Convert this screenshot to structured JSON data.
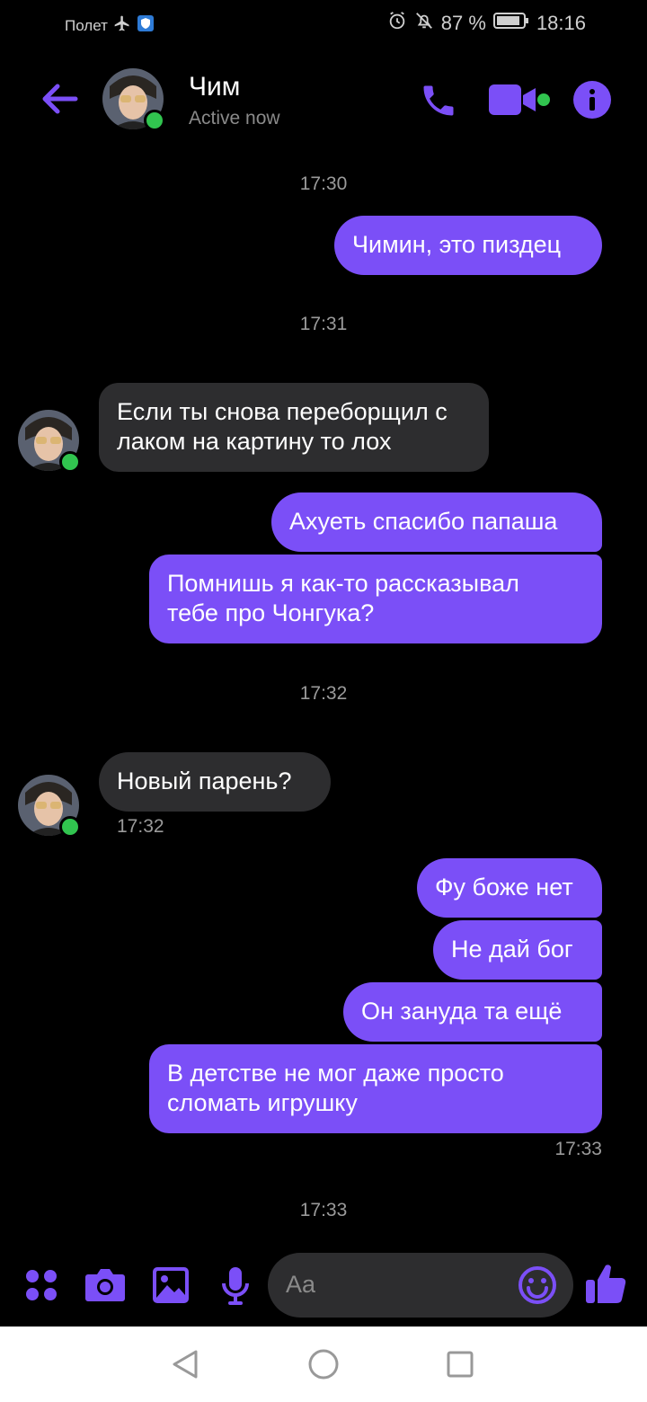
{
  "status_bar": {
    "mode": "Полет",
    "battery": "87 %",
    "time": "18:16"
  },
  "header": {
    "name": "Чим",
    "status": "Active now"
  },
  "timestamps": [
    "17:30",
    "17:31",
    "17:32",
    "17:33"
  ],
  "messages": {
    "m1": "Чимин, это пиздец",
    "m2_line1": "Если ты снова переборщил с",
    "m2_line2": "лаком на картину то лох",
    "m3": "Ахуеть спасибо папаша",
    "m4_line1": "Помнишь я как-то рассказывал",
    "m4_line2": "тебе про Чонгука?",
    "m5": "Новый парень?",
    "m5_time": "17:32",
    "m6": "Фу боже нет",
    "m7": "Не дай бог",
    "m8": "Он зануда та ещё",
    "m9_line1": "В детстве не мог даже просто",
    "m9_line2": "сломать игрушку",
    "m9_time": "17:33"
  },
  "composer": {
    "placeholder": "Aa"
  },
  "colors": {
    "accent": "#7b4ff7",
    "incoming": "#2d2d2f",
    "online": "#31c44f"
  }
}
